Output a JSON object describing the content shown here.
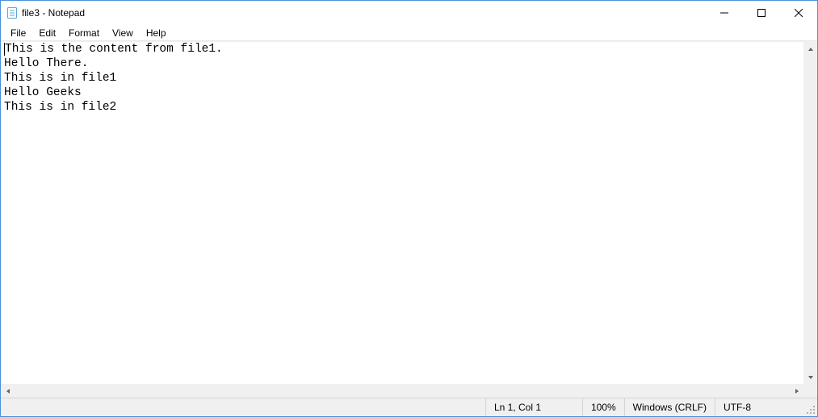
{
  "title": "file3 - Notepad",
  "menu": {
    "file": "File",
    "edit": "Edit",
    "format": "Format",
    "view": "View",
    "help": "Help"
  },
  "content": "This is the content from file1.\nHello There.\nThis is in file1\nHello Geeks\nThis is in file2",
  "status": {
    "position": "Ln 1, Col 1",
    "zoom": "100%",
    "line_ending": "Windows (CRLF)",
    "encoding": "UTF-8"
  }
}
